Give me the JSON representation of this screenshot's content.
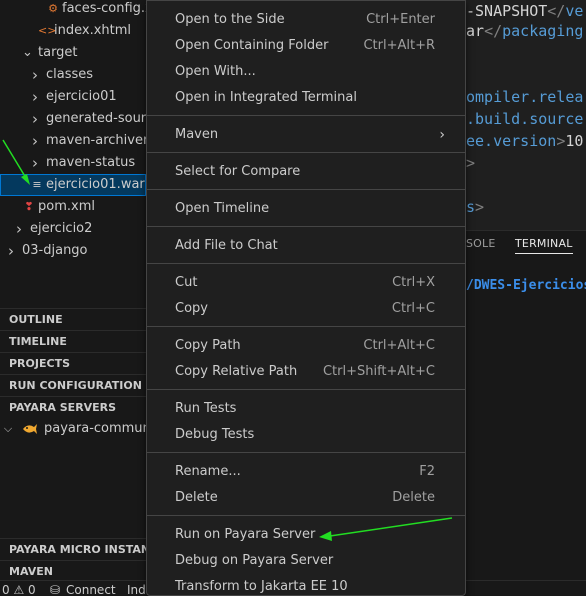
{
  "explorer": {
    "tree": [
      {
        "label": "faces-config.xml",
        "icon": "xml-file-icon"
      },
      {
        "label": "index.xhtml",
        "icon": "code-file-icon"
      },
      {
        "label": "target",
        "chevron": "expanded"
      },
      {
        "label": "classes",
        "chevron": "collapsed"
      },
      {
        "label": "ejercicio01",
        "chevron": "collapsed"
      },
      {
        "label": "generated-sources",
        "chevron": "collapsed"
      },
      {
        "label": "maven-archiver",
        "chevron": "collapsed"
      },
      {
        "label": "maven-status",
        "chevron": "collapsed"
      },
      {
        "label": "ejercicio01.war",
        "icon": "lines-file-icon",
        "selected": true
      },
      {
        "label": "pom.xml",
        "icon": "maven-file-icon"
      },
      {
        "label": "ejercicio2",
        "chevron": "collapsed"
      },
      {
        "label": "03-django",
        "chevron": "collapsed"
      }
    ],
    "sections": {
      "outline": "OUTLINE",
      "timeline": "TIMELINE",
      "projects": "PROJECTS",
      "run_configuration": "RUN CONFIGURATION",
      "payara_servers": "PAYARA SERVERS",
      "payara_item": "payara-community",
      "payara_micro": "PAYARA MICRO INSTANCES",
      "maven": "MAVEN"
    }
  },
  "editor": {
    "lines": [
      {
        "parts": [
          [
            "txt",
            "-SNAPSHOT"
          ],
          [
            "punc",
            "</"
          ],
          [
            "tag",
            "ve"
          ]
        ]
      },
      {
        "parts": [
          [
            "txt",
            "ar"
          ],
          [
            "punc",
            "</"
          ],
          [
            "tag",
            "packaging"
          ]
        ]
      },
      {
        "parts": [
          [
            "tag",
            "ompiler.relea"
          ]
        ]
      },
      {
        "parts": [
          [
            "tag",
            ".build.source"
          ]
        ]
      },
      {
        "parts": [
          [
            "tag",
            "ee.version"
          ],
          [
            "punc",
            ">"
          ],
          [
            "txt",
            "10"
          ]
        ]
      },
      {
        "parts": [
          [
            "punc",
            ">"
          ]
        ]
      },
      {
        "parts": [
          [
            "tag",
            "s"
          ],
          [
            "punc",
            ">"
          ]
        ]
      }
    ]
  },
  "panel": {
    "tabs": [
      "SOLE",
      "TERMINAL"
    ],
    "terminal_line": "/DWES-Ejercicios"
  },
  "statusbar": {
    "problems": "0 ⚠ 0",
    "connect": "Connect",
    "extra": "Ind"
  },
  "context_menu": {
    "groups": [
      [
        {
          "label": "Open to the Side",
          "shortcut": "Ctrl+Enter"
        },
        {
          "label": "Open Containing Folder",
          "shortcut": "Ctrl+Alt+R"
        },
        {
          "label": "Open With...",
          "shortcut": ""
        },
        {
          "label": "Open in Integrated Terminal",
          "shortcut": ""
        }
      ],
      [
        {
          "label": "Maven",
          "shortcut": "",
          "submenu": true
        }
      ],
      [
        {
          "label": "Select for Compare",
          "shortcut": ""
        }
      ],
      [
        {
          "label": "Open Timeline",
          "shortcut": ""
        }
      ],
      [
        {
          "label": "Add File to Chat",
          "shortcut": ""
        }
      ],
      [
        {
          "label": "Cut",
          "shortcut": "Ctrl+X"
        },
        {
          "label": "Copy",
          "shortcut": "Ctrl+C"
        }
      ],
      [
        {
          "label": "Copy Path",
          "shortcut": "Ctrl+Alt+C"
        },
        {
          "label": "Copy Relative Path",
          "shortcut": "Ctrl+Shift+Alt+C"
        }
      ],
      [
        {
          "label": "Run Tests",
          "shortcut": ""
        },
        {
          "label": "Debug Tests",
          "shortcut": ""
        }
      ],
      [
        {
          "label": "Rename...",
          "shortcut": "F2"
        },
        {
          "label": "Delete",
          "shortcut": "Delete"
        }
      ],
      [
        {
          "label": "Run on Payara Server",
          "shortcut": ""
        },
        {
          "label": "Debug on Payara Server",
          "shortcut": ""
        },
        {
          "label": "Transform to Jakarta EE 10",
          "shortcut": ""
        }
      ]
    ]
  },
  "colors": {
    "annotation_arrow": "#22dd22",
    "selection": "#04395e",
    "focus_border": "#0078d4",
    "terminal_path": "#3b8eea"
  }
}
